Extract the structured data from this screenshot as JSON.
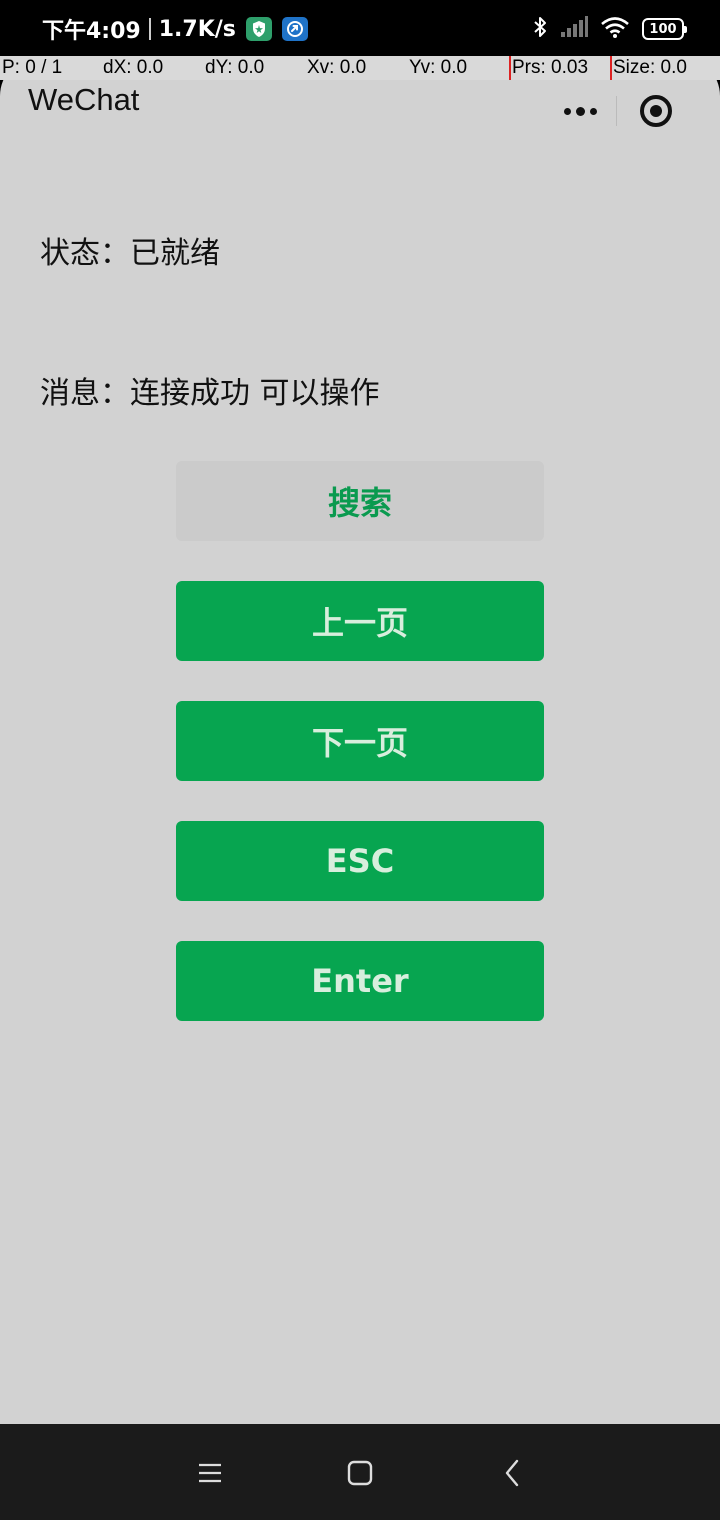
{
  "status_bar": {
    "time": "下午4:09",
    "net_speed": "1.7K/s",
    "battery": "100",
    "icons": [
      "shield-app-icon",
      "link-app-icon",
      "bluetooth-icon",
      "cell-signal-icon",
      "wifi-icon",
      "battery-icon"
    ]
  },
  "debug": {
    "pointer": "P: 0 / 1",
    "dx": "dX: 0.0",
    "dy": "dY: 0.0",
    "xv": "Xv: 0.0",
    "yv": "Yv: 0.0",
    "prs": "Prs: 0.03",
    "size": "Size: 0.0"
  },
  "header": {
    "title": "WeChat",
    "icons": [
      "more-dots-icon",
      "close-target-icon"
    ]
  },
  "main": {
    "status_text": "状态：已就绪",
    "message_text": "消息：连接成功 可以操作",
    "buttons": {
      "search": "搜索",
      "prev_page": "上一页",
      "next_page": "下一页",
      "esc": "ESC",
      "enter": "Enter"
    }
  },
  "nav": {
    "icons": [
      "menu-icon",
      "home-icon",
      "back-icon"
    ]
  },
  "colors": {
    "primary_green": "#07a550",
    "search_text_green": "#0a9a4f",
    "page_bg": "#d2d2d2"
  }
}
